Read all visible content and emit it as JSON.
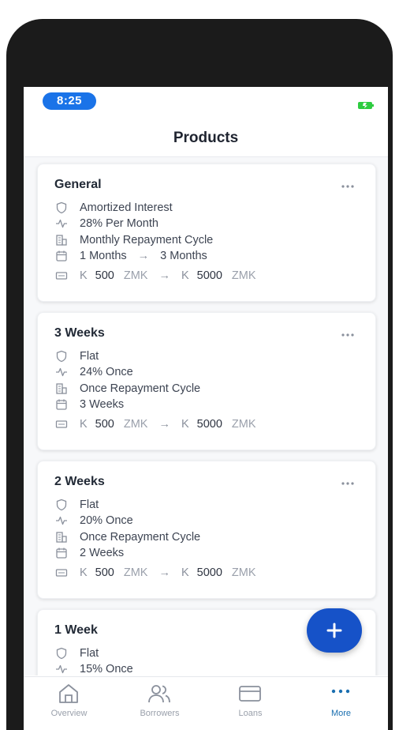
{
  "status_bar": {
    "time": "8:25"
  },
  "header": {
    "title": "Products"
  },
  "products": [
    {
      "name": "General",
      "interest_type": "Amortized Interest",
      "rate": "28% Per Month",
      "repayment_cycle": "Monthly Repayment Cycle",
      "duration_min": "1 Months",
      "duration_max": "3 Months",
      "amount_prefix": "K",
      "amount_min": "500",
      "amount_max": "5000",
      "currency": "ZMK"
    },
    {
      "name": "3 Weeks",
      "interest_type": "Flat",
      "rate": "24% Once",
      "repayment_cycle": "Once Repayment Cycle",
      "duration": "3 Weeks",
      "amount_prefix": "K",
      "amount_min": "500",
      "amount_max": "5000",
      "currency": "ZMK"
    },
    {
      "name": "2 Weeks",
      "interest_type": "Flat",
      "rate": "20% Once",
      "repayment_cycle": "Once Repayment Cycle",
      "duration": "2 Weeks",
      "amount_prefix": "K",
      "amount_min": "500",
      "amount_max": "5000",
      "currency": "ZMK"
    },
    {
      "name": "1 Week",
      "interest_type": "Flat",
      "rate": "15% Once"
    }
  ],
  "tabs": [
    {
      "label": "Overview",
      "icon": "home-icon",
      "active": false
    },
    {
      "label": "Borrowers",
      "icon": "users-icon",
      "active": false
    },
    {
      "label": "Loans",
      "icon": "card-icon",
      "active": false
    },
    {
      "label": "More",
      "icon": "more-icon",
      "active": true
    }
  ],
  "colors": {
    "accent": "#1a73e8",
    "fab": "#1652c8",
    "active_tab": "#1a6fb0",
    "battery": "#2ecc40"
  }
}
